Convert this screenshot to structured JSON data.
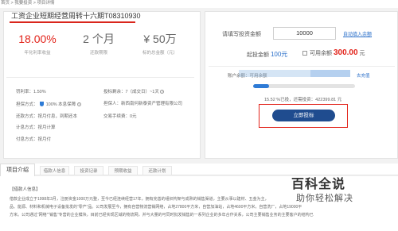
{
  "breadcrumb": {
    "text": "首页 > 我要投资 > 项目详情"
  },
  "loan": {
    "title": "工资企业短期经营周转十六期T08310930",
    "stats": [
      {
        "value": "18.00%",
        "label": "年化利率收益"
      },
      {
        "value": "2 个月",
        "label": "还款期限"
      },
      {
        "value": "¥ 50万",
        "label": "标的总金额（元）"
      }
    ],
    "info": {
      "penalty": "罚利率：1.50%",
      "time_left": "投标剩余：7（成交日）~1天",
      "guarantee_prefix": "担保方式：",
      "guarantee_value": "100% 本息保障",
      "guarantor": "担保人：新西南何新泰资产管理有限公司",
      "repay": "还款方式：按月付息，到期还本",
      "fee": "交易手续费：0元",
      "interest": "计息方式：按月计算",
      "pay": "付息方式：按月付"
    }
  },
  "invest": {
    "input_label": "请填写投资金额",
    "amount": "10000",
    "auto_link": "自动填入余额",
    "min_label": "起投金额",
    "min_value": "100元",
    "balance_label": "可用余额",
    "balance_value": "300.00",
    "balance_unit": "元",
    "usable_text": "账户余额：可用余额",
    "recharge_link": "去充值",
    "progress": 0.1552,
    "progress_text": "15.52 %已投，还需投资：422399.81 元",
    "button_label": "立即投标"
  },
  "tabs": {
    "active": "项目介绍",
    "items": [
      "借款人信息",
      "投资记录",
      "预期收益",
      "还款计划"
    ]
  },
  "content": {
    "section_title": "【借款人信息】",
    "lines": [
      "借款企业成立于1998年3月，注册资金1000万元整，至今已经连续经营17年，拥有完善的组织构架与成熟的销售渠道，主要从事以建材、五金为主，",
      "品、能源、材料和机械电子设备批发的“零产”品。公司发展至今，拥有自营物流营销网络，占地27800平方米，自营加油站，占地4600平方米，自营洗厂，占地19000平",
      "方米。公司通过“网络”“销售”专营的企业模块，目前已经实现区域的物流网，并与大量的可同时批发销售的一系列企业的多年合作关系，公司主要销售业务的主要客户的结构已"
    ]
  },
  "watermark": {
    "title": "百科全说",
    "subtitle": "助你轻松解决"
  }
}
